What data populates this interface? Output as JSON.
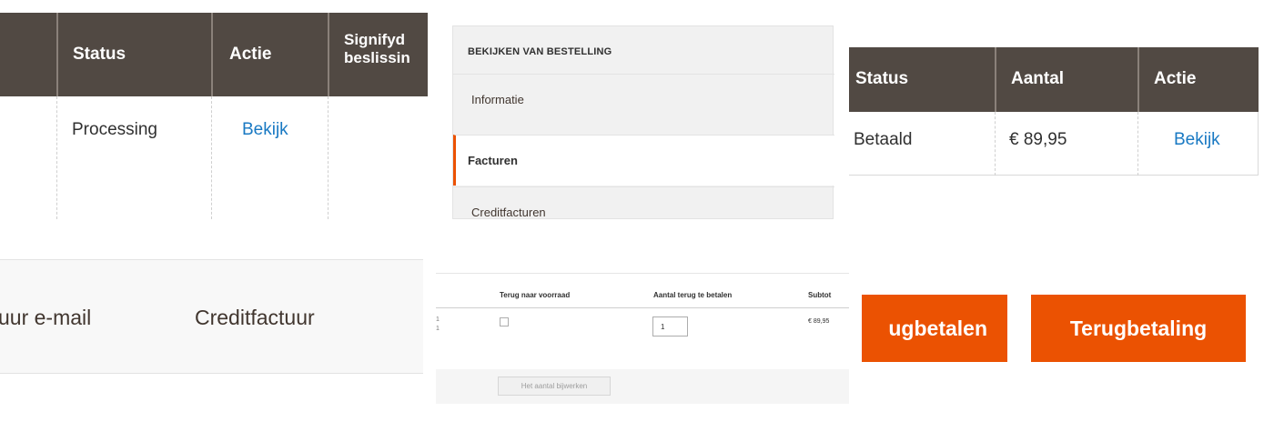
{
  "order_grid": {
    "columns": [
      "Status",
      "Actie",
      "Signifyd",
      "beslissin"
    ],
    "row": {
      "status": "Processing",
      "action": "Bekijk"
    }
  },
  "order_view": {
    "title": "BEKIJKEN VAN BESTELLING",
    "tabs": [
      {
        "label": "Informatie",
        "active": false
      },
      {
        "label": "Facturen",
        "active": true
      },
      {
        "label": "Creditfacturen",
        "active": false
      }
    ]
  },
  "invoice_grid": {
    "columns": [
      "Status",
      "Aantal",
      "Actie"
    ],
    "row": {
      "status": "Betaald",
      "amount": "€ 89,95",
      "action": "Bekijk"
    }
  },
  "order_tabs": {
    "items": [
      "uur e-mail",
      "Creditfactuur"
    ]
  },
  "creditmemo_items": {
    "columns": [
      "Terug naar voorraad",
      "Aantal terug te betalen",
      "Subtot"
    ],
    "row": {
      "qty": "1",
      "subtotal": "€ 89,95",
      "frag1": "1",
      "frag2": "1"
    },
    "update_button": "Het aantal bijwerken"
  },
  "refund_buttons": {
    "offline": "ugbetalen",
    "online": "Terugbetaling"
  },
  "colors": {
    "grid_header": "#514943",
    "accent": "#eb5202",
    "link": "#1979c3"
  }
}
